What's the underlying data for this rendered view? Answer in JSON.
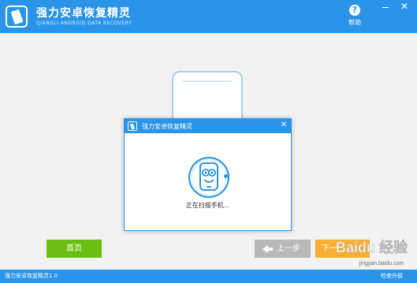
{
  "app": {
    "title": "强力安卓恢复精灵",
    "subtitle": "QIANGLI ANDROID DATA RECOVERY",
    "help_label": "帮助"
  },
  "dialog": {
    "title": "强力安卓恢复精灵",
    "status": "正在扫描手机..."
  },
  "buttons": {
    "home": "首页",
    "prev": "上一步",
    "next": "下一"
  },
  "watermark": {
    "text": "Baidu 经验",
    "url": "jingyan.baidu.com"
  },
  "footer": {
    "version": "强力安卓恢复精灵1.0",
    "upgrade": "检查升级"
  },
  "colors": {
    "primary": "#2a94e8",
    "home_button": "#69c012",
    "prev_button": "#b8b8b8",
    "next_button": "#f5b031"
  },
  "icons": {
    "logo": "phone-logo-icon",
    "help": "help-icon",
    "minimize": "minimize-icon",
    "close": "close-icon",
    "scan": "robot-scan-icon",
    "prev_arrow": "arrow-left-icon"
  }
}
